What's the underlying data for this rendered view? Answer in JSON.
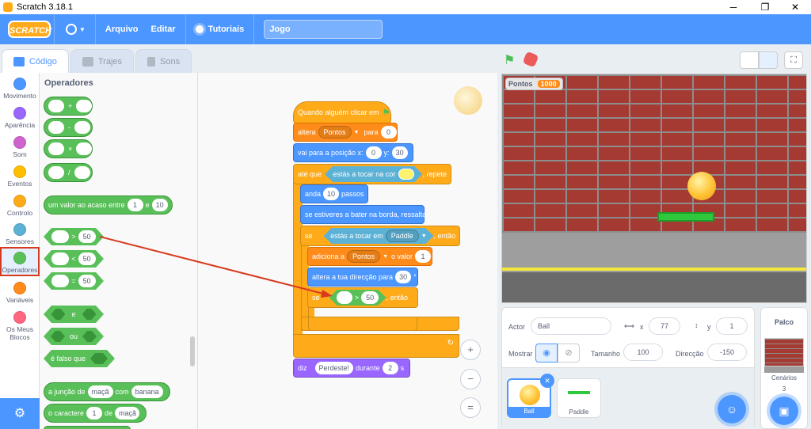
{
  "window": {
    "title": "Scratch 3.18.1",
    "minimize": "─",
    "maximize": "❐",
    "close": "✕"
  },
  "menubar": {
    "logo": "SCRATCH",
    "file": "Arquivo",
    "edit": "Editar",
    "tutorials": "Tutoriais",
    "project_name": "Jogo"
  },
  "tabs": [
    {
      "label": "Código"
    },
    {
      "label": "Trajes"
    },
    {
      "label": "Sons"
    }
  ],
  "categories": [
    {
      "label": "Movimento",
      "color": "#4c97ff"
    },
    {
      "label": "Aparência",
      "color": "#9966ff"
    },
    {
      "label": "Som",
      "color": "#cf63cf"
    },
    {
      "label": "Eventos",
      "color": "#ffbf00"
    },
    {
      "label": "Controlo",
      "color": "#ffab19"
    },
    {
      "label": "Sensores",
      "color": "#5cb1d6"
    },
    {
      "label": "Operadores",
      "color": "#59c059"
    },
    {
      "label": "Variáveis",
      "color": "#ff8c1a"
    },
    {
      "label": "Os Meus Blocos",
      "color": "#ff6680"
    }
  ],
  "palette": {
    "title": "Operadores",
    "plus": "+",
    "minus": "-",
    "times": "×",
    "divide": "/",
    "random": {
      "text": "um valor ao acaso entre",
      "a": "1",
      "and": "e",
      "b": "10"
    },
    "gt": {
      "op": ">",
      "val": "50"
    },
    "lt": {
      "op": "<",
      "val": "50"
    },
    "eq": {
      "op": "=",
      "val": "50"
    },
    "and_label": "e",
    "or_label": "ou",
    "not_label": "é falso que",
    "join": {
      "text": "a junção de",
      "a": "maçã",
      "with": "com",
      "b": "banana"
    },
    "letter": {
      "text": "o caractere",
      "n": "1",
      "of": "de",
      "s": "maçã"
    }
  },
  "script": {
    "hat": "Quando alguém clicar em",
    "set": {
      "t1": "altera",
      "var": "Pontos",
      "t2": "para",
      "val": "0"
    },
    "goto": {
      "t1": "vai para a posição x:",
      "x": "0",
      "t2": "y:",
      "y": "30"
    },
    "until": {
      "t1": "até que",
      "touch": "estás a tocar na cor",
      "t2": ", repete"
    },
    "move": {
      "t1": "anda",
      "n": "10",
      "t2": "passos"
    },
    "bounce": "se estiveres a bater na borda, ressalta",
    "if1": {
      "t1": "se",
      "touch": "estás a tocar em",
      "obj": "Paddle",
      "t2": ", então"
    },
    "change": {
      "t1": "adiciona a",
      "var": "Pontos",
      "t2": "o valor",
      "val": "1"
    },
    "point": {
      "t1": "altera a tua direcção para",
      "val": "30",
      "deg": "°"
    },
    "if2": {
      "t1": "se",
      "op": ">",
      "val": "50",
      "t2": ", então"
    },
    "say": {
      "t1": "diz",
      "msg": "Perdeste!",
      "t2": "durante",
      "secs": "2",
      "t3": "s"
    }
  },
  "zoom": {
    "in": "+",
    "out": "−",
    "reset": "="
  },
  "stage": {
    "monitor_label": "Pontos",
    "monitor_value": "1000"
  },
  "sprite_info": {
    "sprite_label": "Actor",
    "sprite_name": "Ball",
    "x_label": "x",
    "x": "77",
    "y_label": "y",
    "y": "1",
    "show_label": "Mostrar",
    "size_label": "Tamanho",
    "size": "100",
    "direction_label": "Direcção",
    "direction": "-150"
  },
  "sprites": [
    {
      "name": "Ball"
    },
    {
      "name": "Paddle"
    }
  ],
  "stage_panel": {
    "title": "Palco",
    "backdrops_label": "Cenários",
    "backdrops_count": "3"
  }
}
